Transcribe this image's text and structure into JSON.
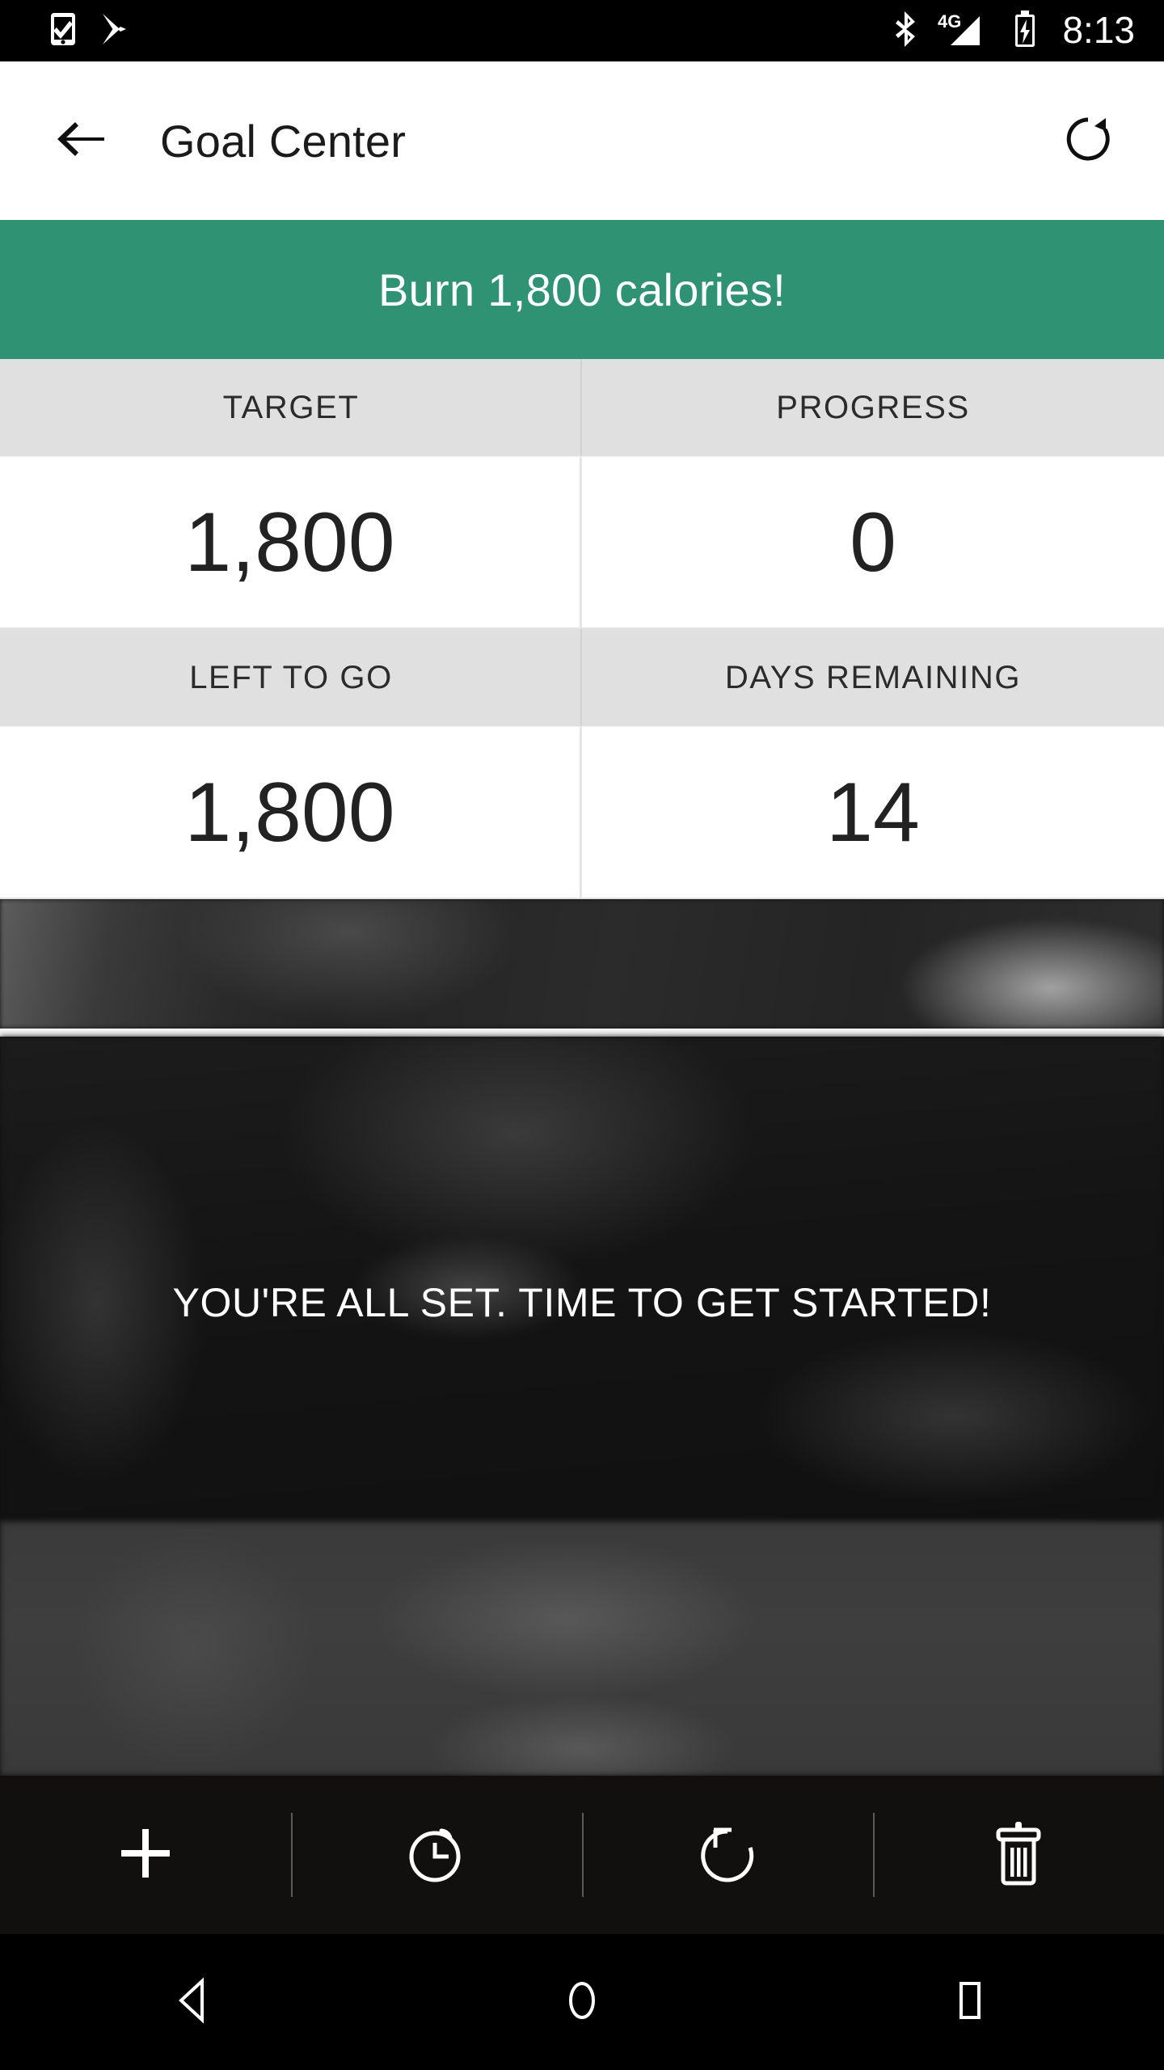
{
  "status_bar": {
    "left_icons": [
      {
        "name": "phone-check-icon",
        "label": "Phone with checkmark"
      },
      {
        "name": "play-store-icon",
        "label": "Google Play"
      }
    ],
    "right_icons": [
      {
        "name": "bluetooth-icon",
        "label": "Bluetooth"
      },
      {
        "name": "signal-4g-icon",
        "label": "4G"
      },
      {
        "name": "battery-charging-icon",
        "label": "Battery charging"
      }
    ],
    "network_label": "4G",
    "clock": "8:13"
  },
  "app_bar": {
    "back_icon": "arrow-left-icon",
    "title": "Goal Center",
    "refresh_icon": "refresh-icon"
  },
  "banner": {
    "text": "Burn 1,800 calories!",
    "background_color": "#2F9273",
    "text_color": "#FFFFFF"
  },
  "stats": {
    "header_background": "#E0E0E0",
    "value_background": "#FFFFFF",
    "rows": [
      {
        "cells": [
          {
            "label": "TARGET",
            "value": "1,800"
          },
          {
            "label": "PROGRESS",
            "value": "0"
          }
        ]
      },
      {
        "cells": [
          {
            "label": "LEFT TO GO",
            "value": "1,800"
          },
          {
            "label": "DAYS REMAINING",
            "value": "14"
          }
        ]
      }
    ]
  },
  "hero": {
    "message": "YOU'RE ALL SET. TIME TO GET STARTED!",
    "message_color": "#FFFFFF",
    "background_description": "blurred dark photo"
  },
  "toolbar": {
    "background_color": "#120F0F",
    "buttons": [
      {
        "name": "add-button",
        "icon": "plus-icon",
        "label": "Add"
      },
      {
        "name": "timer-button",
        "icon": "timer-icon",
        "label": "Timer"
      },
      {
        "name": "reset-button",
        "icon": "reset-rotate-icon",
        "label": "Reset"
      },
      {
        "name": "delete-button",
        "icon": "trash-icon",
        "label": "Delete"
      }
    ]
  },
  "nav_bar": {
    "background_color": "#000000",
    "buttons": [
      {
        "name": "android-back-button",
        "icon": "triangle-left-icon",
        "label": "Back"
      },
      {
        "name": "android-home-button",
        "icon": "circle-icon",
        "label": "Home"
      },
      {
        "name": "android-recents-button",
        "icon": "square-icon",
        "label": "Recents"
      }
    ]
  }
}
